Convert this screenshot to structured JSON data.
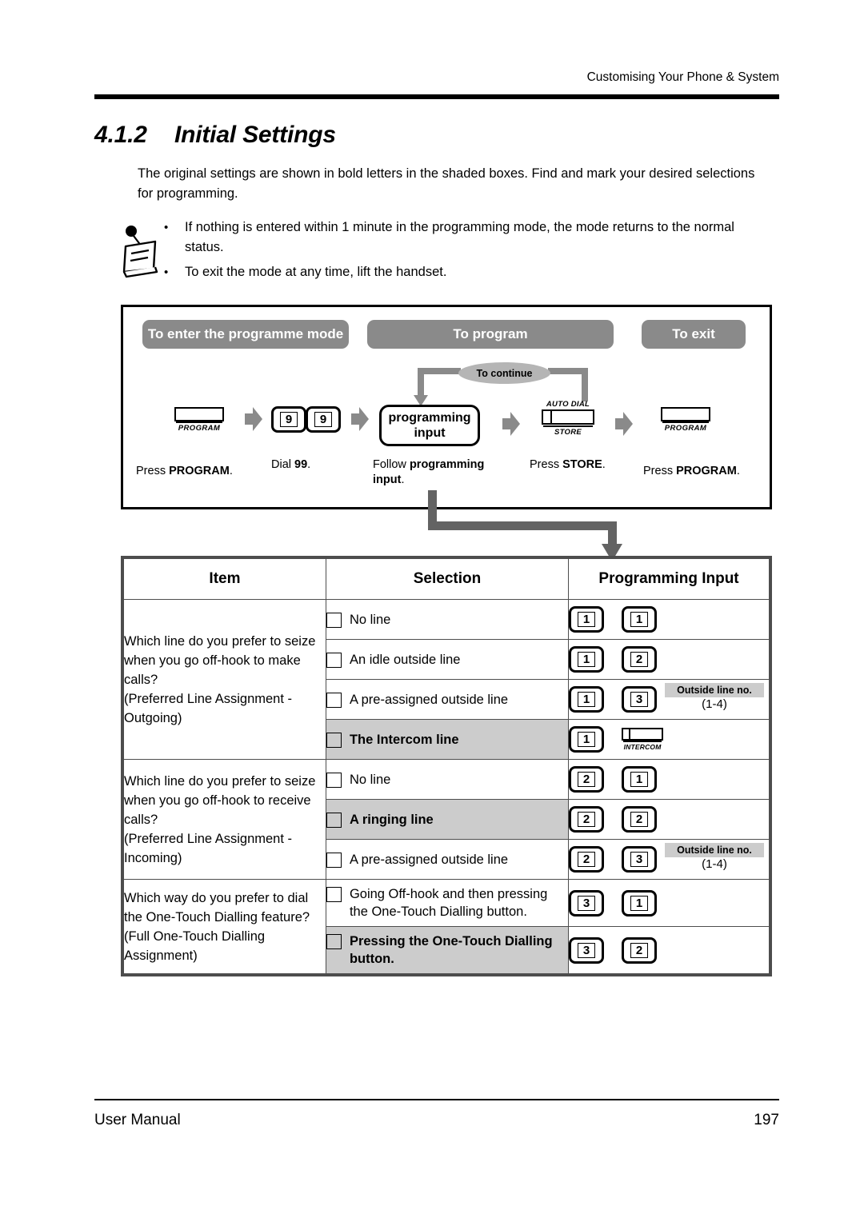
{
  "header": {
    "running_head": "Customising Your Phone & System"
  },
  "section": {
    "number": "4.1.2",
    "title": "Initial Settings"
  },
  "intro": "The original settings are shown in bold letters in the shaded boxes. Find and mark your desired selections for programming.",
  "notes": {
    "icon": "note-paper-icon",
    "bullet": "•",
    "items": [
      "If nothing is entered within 1 minute in the programming mode, the mode returns to the normal status.",
      "To exit the mode at any time, lift the handset."
    ]
  },
  "flow": {
    "pill_enter": "To enter the programme mode",
    "pill_program": "To program",
    "pill_exit": "To exit",
    "continue_label": "To continue",
    "step1": {
      "key_label": "PROGRAM",
      "caption_pre": "Press ",
      "caption_bold": "PROGRAM",
      "caption_post": "."
    },
    "step2": {
      "key1": "9",
      "key2": "9",
      "caption_pre": "Dial ",
      "caption_bold": "99",
      "caption_post": "."
    },
    "step3": {
      "box_line1": "programming",
      "box_line2": "input",
      "caption_pre": "Follow ",
      "caption_bold": "programming input",
      "caption_post": "."
    },
    "step4": {
      "key_top": "AUTO DIAL",
      "key_bottom": "STORE",
      "caption_pre": "Press ",
      "caption_bold": "STORE",
      "caption_post": "."
    },
    "step5": {
      "key_label": "PROGRAM",
      "caption_pre": "Press ",
      "caption_bold": "PROGRAM",
      "caption_post": "."
    }
  },
  "table": {
    "columns": [
      "Item",
      "Selection",
      "Programming Input"
    ],
    "groups": [
      {
        "item": "Which line do you prefer to seize when you go off-hook to make calls?\n(Preferred Line Assignment - Outgoing)",
        "rows": [
          {
            "selection": "No line",
            "default": false,
            "keys": [
              "1",
              "1"
            ],
            "extra": null
          },
          {
            "selection": "An idle outside line",
            "default": false,
            "keys": [
              "1",
              "2"
            ],
            "extra": null
          },
          {
            "selection": "A pre-assigned outside line",
            "default": false,
            "keys": [
              "1",
              "3"
            ],
            "extra": {
              "tag": "Outside line no.",
              "range": "(1-4)"
            }
          },
          {
            "selection": "The Intercom line",
            "default": true,
            "keys": [
              "1"
            ],
            "special_key": "INTERCOM",
            "extra": null
          }
        ]
      },
      {
        "item": "Which line do you prefer to seize when you go off-hook to receive calls?\n(Preferred Line Assignment - Incoming)",
        "rows": [
          {
            "selection": "No line",
            "default": false,
            "keys": [
              "2",
              "1"
            ],
            "extra": null
          },
          {
            "selection": "A ringing line",
            "default": true,
            "keys": [
              "2",
              "2"
            ],
            "extra": null
          },
          {
            "selection": "A pre-assigned outside line",
            "default": false,
            "keys": [
              "2",
              "3"
            ],
            "extra": {
              "tag": "Outside line no.",
              "range": "(1-4)"
            }
          }
        ]
      },
      {
        "item": "Which way do you prefer to dial the One-Touch Dialling feature?\n(Full One-Touch Dialling Assignment)",
        "rows": [
          {
            "selection": "Going Off-hook and then pressing the One-Touch Dialling button.",
            "default": false,
            "keys": [
              "3",
              "1"
            ],
            "extra": null
          },
          {
            "selection": "Pressing the One-Touch Dialling button.",
            "default": true,
            "keys": [
              "3",
              "2"
            ],
            "extra": null
          }
        ]
      }
    ]
  },
  "footer": {
    "left": "User Manual",
    "page": "197"
  },
  "colors": {
    "pill_grey": "#8a8a8a",
    "oval_grey": "#b5b5b5",
    "shade_grey": "#cccccc",
    "border_grey": "#4d4d4d",
    "connector_grey": "#636363"
  }
}
